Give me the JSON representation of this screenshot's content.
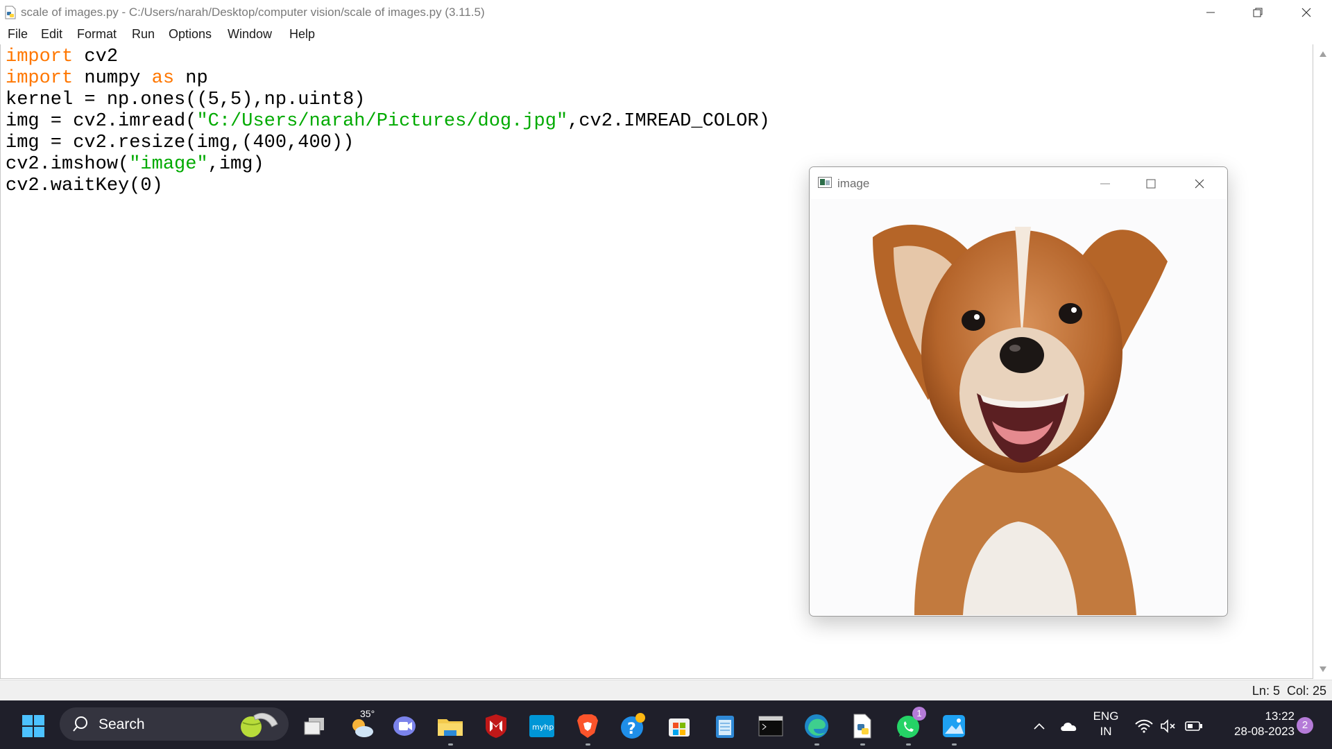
{
  "idle": {
    "window_title": "scale of images.py - C:/Users/narah/Desktop/computer vision/scale of images.py (3.11.5)",
    "menu": [
      "File",
      "Edit",
      "Format",
      "Run",
      "Options",
      "Window",
      "Help"
    ],
    "code": [
      [
        {
          "t": "import",
          "c": "kw"
        },
        {
          "t": " cv2",
          "c": ""
        }
      ],
      [
        {
          "t": "import",
          "c": "kw"
        },
        {
          "t": " numpy ",
          "c": ""
        },
        {
          "t": "as",
          "c": "kw"
        },
        {
          "t": " np",
          "c": ""
        }
      ],
      [
        {
          "t": "kernel = np.ones((5,5),np.uint8)",
          "c": ""
        }
      ],
      [
        {
          "t": "img = cv2.imread(",
          "c": ""
        },
        {
          "t": "\"C:/Users/narah/Pictures/dog.jpg\"",
          "c": "str"
        },
        {
          "t": ",cv2.IMREAD_COLOR)",
          "c": ""
        }
      ],
      [
        {
          "t": "img = cv2.resize(img,(400,400))",
          "c": ""
        }
      ],
      [
        {
          "t": "cv2.imshow(",
          "c": ""
        },
        {
          "t": "\"image\"",
          "c": "str"
        },
        {
          "t": ",img)",
          "c": ""
        }
      ],
      [
        {
          "t": "cv2.waitKey(0)",
          "c": ""
        }
      ]
    ],
    "status": "Ln: 5  Col: 25"
  },
  "cv_window": {
    "title": "image"
  },
  "taskbar": {
    "search_label": "Search",
    "weather_temp": "35°",
    "lang_line1": "ENG",
    "lang_line2": "IN",
    "time": "13:22",
    "date": "28-08-2023",
    "notification_count": "2",
    "whatsapp_badge": "1"
  },
  "colors": {
    "keyword": "#ff7700",
    "string": "#00aa00",
    "taskbar_bg": "#1f1f2a"
  }
}
